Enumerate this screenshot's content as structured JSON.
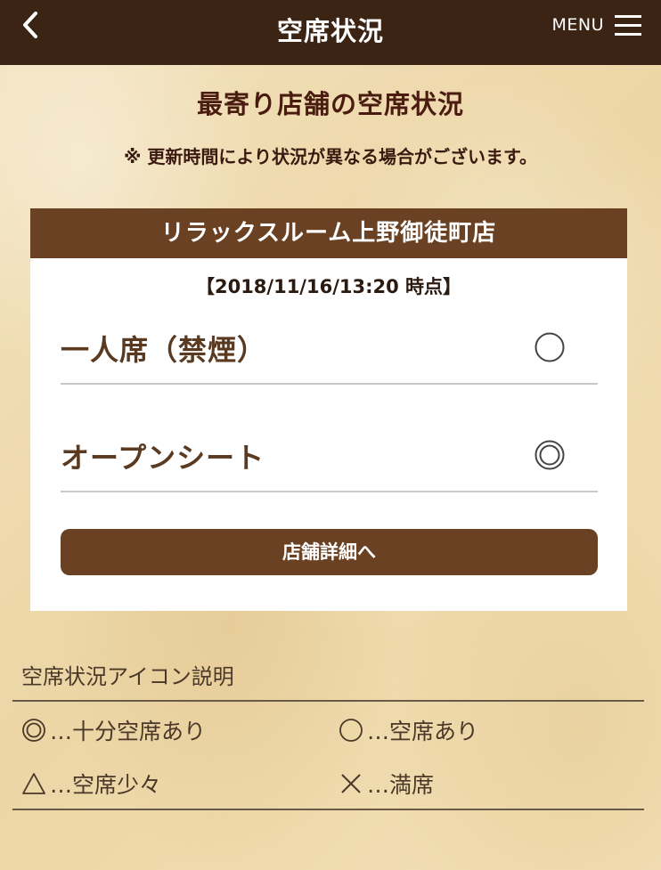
{
  "header": {
    "title": "空席状況",
    "menu_label": "MENU",
    "back_icon": "chevron-left-icon",
    "menu_icon": "hamburger-icon"
  },
  "page": {
    "heading": "最寄り店舗の空席状況",
    "notice": "※ 更新時間により状況が異なる場合がございます。"
  },
  "store": {
    "name": "リラックスルーム上野御徒町店",
    "timestamp": "【2018/11/16/13:20 時点】",
    "seats": [
      {
        "name": "一人席（禁煙）",
        "status": "available",
        "status_icon": "single-circle-icon"
      },
      {
        "name": "オープンシート",
        "status": "plenty-available",
        "status_icon": "double-circle-icon"
      }
    ],
    "detail_button": "店舗詳細へ"
  },
  "legend": {
    "title": "空席状況アイコン説明",
    "items": [
      {
        "symbol": "double-circle-icon",
        "label": "…十分空席あり"
      },
      {
        "symbol": "single-circle-icon",
        "label": "…空席あり"
      },
      {
        "symbol": "triangle-icon",
        "label": "…空席少々"
      },
      {
        "symbol": "cross-icon",
        "label": "…満席"
      }
    ]
  },
  "colors": {
    "topbar": "#3b2414",
    "accent_brown": "#6a4223",
    "heading_text": "#4a1c10",
    "background_paper": "#f1deb4"
  }
}
